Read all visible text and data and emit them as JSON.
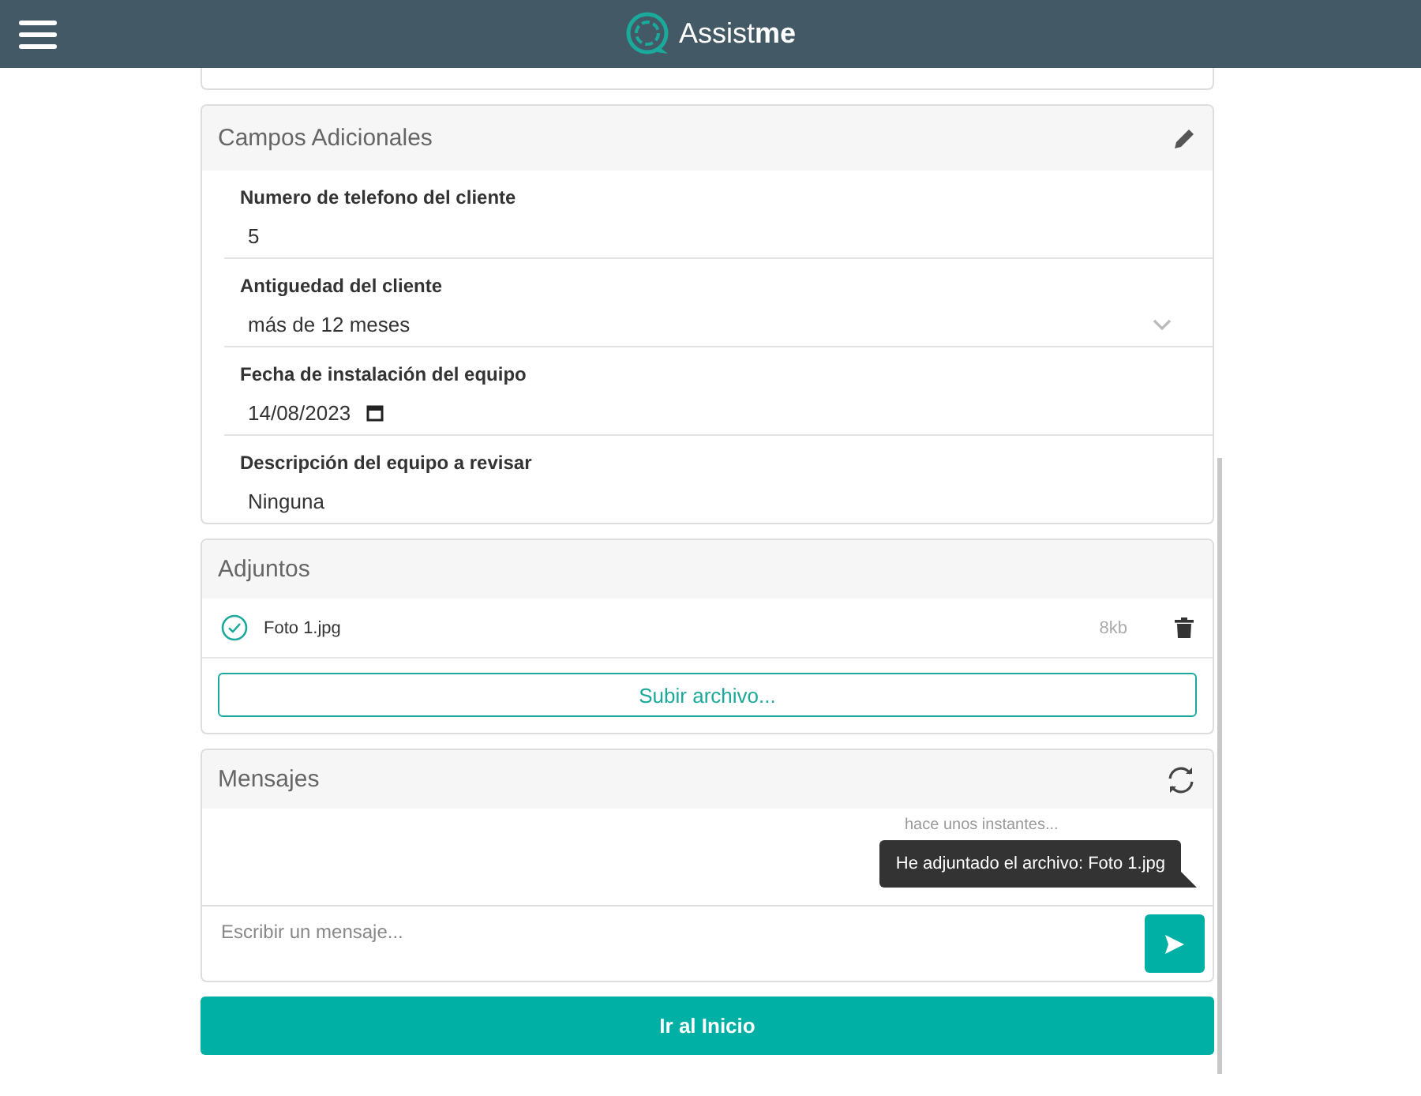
{
  "header": {
    "logo_text": "Assist",
    "logo_bold": "me"
  },
  "additional_fields": {
    "title": "Campos Adicionales",
    "fields": [
      {
        "kind": "text",
        "label": "Numero de telefono del cliente",
        "value": "5"
      },
      {
        "kind": "select",
        "label": "Antiguedad del cliente",
        "value": "más de 12 meses"
      },
      {
        "kind": "date",
        "label": "Fecha de instalación del equipo",
        "value": "14/08/2023"
      },
      {
        "kind": "text",
        "label": "Descripción del equipo a revisar",
        "value": "Ninguna"
      }
    ]
  },
  "attachments": {
    "title": "Adjuntos",
    "files": [
      {
        "name": "Foto 1.jpg",
        "size": "8kb",
        "uploaded": true
      }
    ],
    "upload_button": "Subir archivo..."
  },
  "messages": {
    "title": "Mensajes",
    "items": [
      {
        "time": "hace unos instantes...",
        "text": "He adjuntado el archivo: Foto 1.jpg"
      }
    ],
    "placeholder": "Escribir un mensaje..."
  },
  "home_button": "Ir al Inicio"
}
